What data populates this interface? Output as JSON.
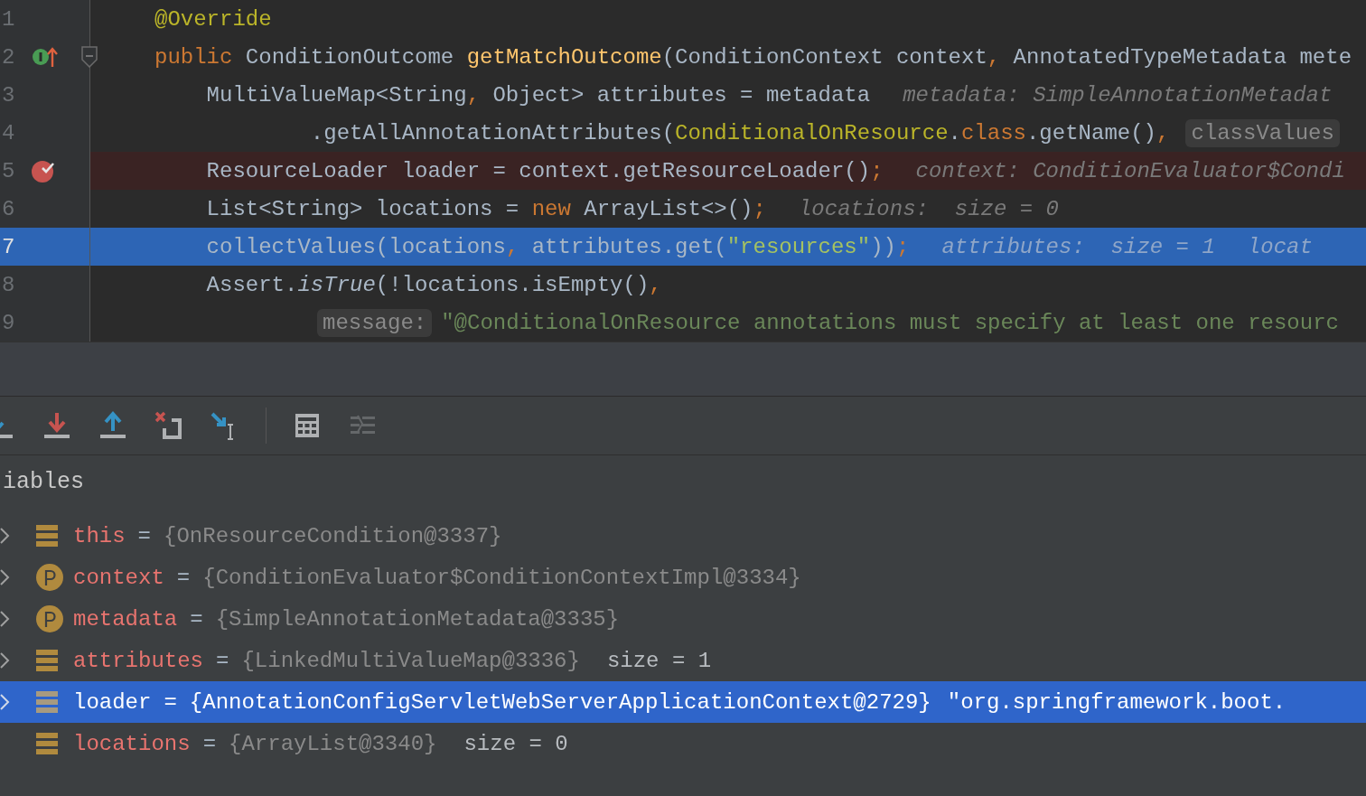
{
  "editor": {
    "lines": [
      {
        "number": "1",
        "breakpoint": false,
        "current": false,
        "override": false,
        "fold": false,
        "tokens": [
          {
            "kind": "annotation",
            "text": "@Override"
          }
        ]
      },
      {
        "number": "2",
        "breakpoint": false,
        "current": false,
        "override": true,
        "fold": true,
        "tokens": [
          {
            "kind": "keyword",
            "text": "public"
          },
          {
            "kind": "plain",
            "text": " ConditionOutcome "
          },
          {
            "kind": "method",
            "text": "getMatchOutcome"
          },
          {
            "kind": "plain",
            "text": "(ConditionContext context"
          },
          {
            "kind": "punct",
            "text": ","
          },
          {
            "kind": "plain",
            "text": " AnnotatedTypeMetadata mete"
          }
        ]
      },
      {
        "number": "3",
        "breakpoint": false,
        "current": false,
        "override": false,
        "fold": false,
        "tokens": [
          {
            "kind": "plain",
            "text": "    MultiValueMap<String"
          },
          {
            "kind": "punct",
            "text": ","
          },
          {
            "kind": "plain",
            "text": " Object> attributes = metadata"
          },
          {
            "kind": "hint",
            "text": "metadata: SimpleAnnotationMetadat"
          }
        ]
      },
      {
        "number": "4",
        "breakpoint": false,
        "current": false,
        "override": false,
        "fold": false,
        "tokens": [
          {
            "kind": "plain",
            "text": "            .getAllAnnotationAttributes("
          },
          {
            "kind": "classref",
            "text": "ConditionalOnResource"
          },
          {
            "kind": "plain",
            "text": "."
          },
          {
            "kind": "keyword",
            "text": "class"
          },
          {
            "kind": "plain",
            "text": ".getName()"
          },
          {
            "kind": "punct",
            "text": ","
          },
          {
            "kind": "param",
            "text": "classValues"
          }
        ]
      },
      {
        "number": "5",
        "breakpoint": true,
        "current": false,
        "override": false,
        "fold": false,
        "tokens": [
          {
            "kind": "plain",
            "text": "    ResourceLoader loader = context.getResourceLoader()"
          },
          {
            "kind": "punct",
            "text": ";"
          },
          {
            "kind": "hint",
            "text": "context: ConditionEvaluator$Condi"
          }
        ]
      },
      {
        "number": "6",
        "breakpoint": false,
        "current": false,
        "override": false,
        "fold": false,
        "tokens": [
          {
            "kind": "plain",
            "text": "    List<String> locations = "
          },
          {
            "kind": "keyword",
            "text": "new"
          },
          {
            "kind": "plain",
            "text": " ArrayList<>()"
          },
          {
            "kind": "punct",
            "text": ";"
          },
          {
            "kind": "hint",
            "text": "locations:  size = 0"
          }
        ]
      },
      {
        "number": "7",
        "breakpoint": false,
        "current": true,
        "override": false,
        "fold": false,
        "tokens": [
          {
            "kind": "plain",
            "text": "    collectValues(locations"
          },
          {
            "kind": "punct",
            "text": ","
          },
          {
            "kind": "plain",
            "text": " attributes.get("
          },
          {
            "kind": "string",
            "text": "\"resources\""
          },
          {
            "kind": "plain",
            "text": "))"
          },
          {
            "kind": "punct",
            "text": ";"
          },
          {
            "kind": "hint",
            "text": "attributes:  size = 1"
          },
          {
            "kind": "hint",
            "text": "locat"
          }
        ]
      },
      {
        "number": "8",
        "breakpoint": false,
        "current": false,
        "override": false,
        "fold": false,
        "tokens": [
          {
            "kind": "plain",
            "text": "    Assert."
          },
          {
            "kind": "italic",
            "text": "isTrue"
          },
          {
            "kind": "plain",
            "text": "(!locations.isEmpty()"
          },
          {
            "kind": "punct",
            "text": ","
          }
        ]
      },
      {
        "number": "9",
        "kind": "continuation",
        "breakpoint": false,
        "current": false,
        "override": false,
        "fold": false,
        "tokens": [
          {
            "kind": "param",
            "text": "message:"
          },
          {
            "kind": "string",
            "text": "\"@ConditionalOnResource annotations must specify at least one resourc"
          }
        ]
      }
    ]
  },
  "toolbar": [
    {
      "kind": "step-over",
      "disabled": false
    },
    {
      "kind": "step-into",
      "disabled": false
    },
    {
      "kind": "step-out",
      "disabled": false
    },
    {
      "kind": "drop-frame",
      "disabled": false
    },
    {
      "kind": "run-to-cursor",
      "disabled": false
    },
    {
      "kind": "separator"
    },
    {
      "kind": "evaluate",
      "disabled": false
    },
    {
      "kind": "trace",
      "disabled": true
    }
  ],
  "variables": {
    "title": "iables",
    "rows": [
      {
        "kind": "field",
        "expandable": true,
        "selected": false,
        "name": "this",
        "operator": "=",
        "value": "{OnResourceCondition@3337}"
      },
      {
        "kind": "param",
        "expandable": true,
        "selected": false,
        "name": "context",
        "operator": "=",
        "value": "{ConditionEvaluator$ConditionContextImpl@3334}"
      },
      {
        "kind": "param",
        "expandable": true,
        "selected": false,
        "name": "metadata",
        "operator": "=",
        "value": "{SimpleAnnotationMetadata@3335}"
      },
      {
        "kind": "field",
        "expandable": true,
        "selected": false,
        "name": "attributes",
        "operator": "=",
        "value": "{LinkedMultiValueMap@3336}",
        "extra": "size = 1"
      },
      {
        "kind": "field",
        "expandable": true,
        "selected": true,
        "name": "loader",
        "operator": "=",
        "value": "{AnnotationConfigServletWebServerApplicationContext@2729}",
        "extra": "\"org.springframework.boot."
      },
      {
        "kind": "field",
        "expandable": false,
        "selected": false,
        "name": "locations",
        "operator": "=",
        "value": "{ArrayList@3340}",
        "extra": "size = 0"
      }
    ]
  }
}
